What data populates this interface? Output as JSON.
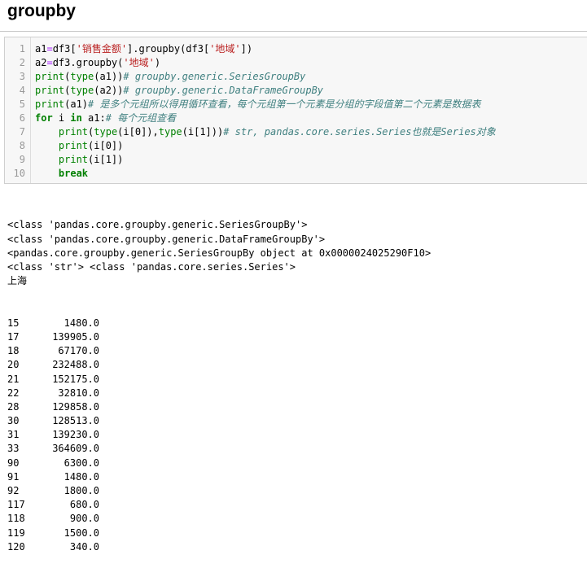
{
  "heading": "groupby",
  "line_numbers": [
    "1",
    "2",
    "3",
    "4",
    "5",
    "6",
    "7",
    "8",
    "9",
    "10"
  ],
  "code_lines": [
    [
      {
        "t": "a1",
        "c": ""
      },
      {
        "t": "=",
        "c": "op"
      },
      {
        "t": "df3[",
        "c": ""
      },
      {
        "t": "'销售金额'",
        "c": "st"
      },
      {
        "t": "].groupby(df3[",
        "c": ""
      },
      {
        "t": "'地域'",
        "c": "st"
      },
      {
        "t": "])",
        "c": ""
      }
    ],
    [
      {
        "t": "a2",
        "c": ""
      },
      {
        "t": "=",
        "c": "op"
      },
      {
        "t": "df3.groupby(",
        "c": ""
      },
      {
        "t": "'地域'",
        "c": "st"
      },
      {
        "t": ")",
        "c": ""
      }
    ],
    [
      {
        "t": "print",
        "c": "bi"
      },
      {
        "t": "(",
        "c": ""
      },
      {
        "t": "type",
        "c": "bi"
      },
      {
        "t": "(a1))",
        "c": ""
      },
      {
        "t": "# groupby.generic.SeriesGroupBy",
        "c": "cm"
      }
    ],
    [
      {
        "t": "print",
        "c": "bi"
      },
      {
        "t": "(",
        "c": ""
      },
      {
        "t": "type",
        "c": "bi"
      },
      {
        "t": "(a2))",
        "c": ""
      },
      {
        "t": "# groupby.generic.DataFrameGroupBy",
        "c": "cm"
      }
    ],
    [
      {
        "t": "print",
        "c": "bi"
      },
      {
        "t": "(a1)",
        "c": ""
      },
      {
        "t": "# 是多个元组所以得用循环查看，每个元组第一个元素是分组的字段值第二个元素是数据表",
        "c": "cm"
      }
    ],
    [
      {
        "t": "for",
        "c": "kw"
      },
      {
        "t": " i ",
        "c": ""
      },
      {
        "t": "in",
        "c": "kw"
      },
      {
        "t": " a1:",
        "c": ""
      },
      {
        "t": "# 每个元组查看",
        "c": "cm"
      }
    ],
    [
      {
        "t": "    ",
        "c": ""
      },
      {
        "t": "print",
        "c": "bi"
      },
      {
        "t": "(",
        "c": ""
      },
      {
        "t": "type",
        "c": "bi"
      },
      {
        "t": "(i[0]),",
        "c": ""
      },
      {
        "t": "type",
        "c": "bi"
      },
      {
        "t": "(i[1]))",
        "c": ""
      },
      {
        "t": "# str, pandas.core.series.Series也就是Series对象",
        "c": "cm"
      }
    ],
    [
      {
        "t": "    ",
        "c": ""
      },
      {
        "t": "print",
        "c": "bi"
      },
      {
        "t": "(i[0])",
        "c": ""
      }
    ],
    [
      {
        "t": "    ",
        "c": ""
      },
      {
        "t": "print",
        "c": "bi"
      },
      {
        "t": "(i[1])",
        "c": ""
      }
    ],
    [
      {
        "t": "    ",
        "c": ""
      },
      {
        "t": "break",
        "c": "kw"
      }
    ]
  ],
  "output_lines": [
    "<class 'pandas.core.groupby.generic.SeriesGroupBy'>",
    "<class 'pandas.core.groupby.generic.DataFrameGroupBy'>",
    "<pandas.core.groupby.generic.SeriesGroupBy object at 0x0000024025290F10>",
    "<class 'str'> <class 'pandas.core.series.Series'>",
    "上海"
  ],
  "series_rows": [
    {
      "index": "15",
      "value": "1480.0"
    },
    {
      "index": "17",
      "value": "139905.0"
    },
    {
      "index": "18",
      "value": "67170.0"
    },
    {
      "index": "20",
      "value": "232488.0"
    },
    {
      "index": "21",
      "value": "152175.0"
    },
    {
      "index": "22",
      "value": "32810.0"
    },
    {
      "index": "28",
      "value": "129858.0"
    },
    {
      "index": "30",
      "value": "128513.0"
    },
    {
      "index": "31",
      "value": "139230.0"
    },
    {
      "index": "33",
      "value": "364609.0"
    },
    {
      "index": "90",
      "value": "6300.0"
    },
    {
      "index": "91",
      "value": "1480.0"
    },
    {
      "index": "92",
      "value": "1800.0"
    },
    {
      "index": "117",
      "value": "680.0"
    },
    {
      "index": "118",
      "value": "900.0"
    },
    {
      "index": "119",
      "value": "1500.0"
    },
    {
      "index": "120",
      "value": "340.0"
    }
  ]
}
